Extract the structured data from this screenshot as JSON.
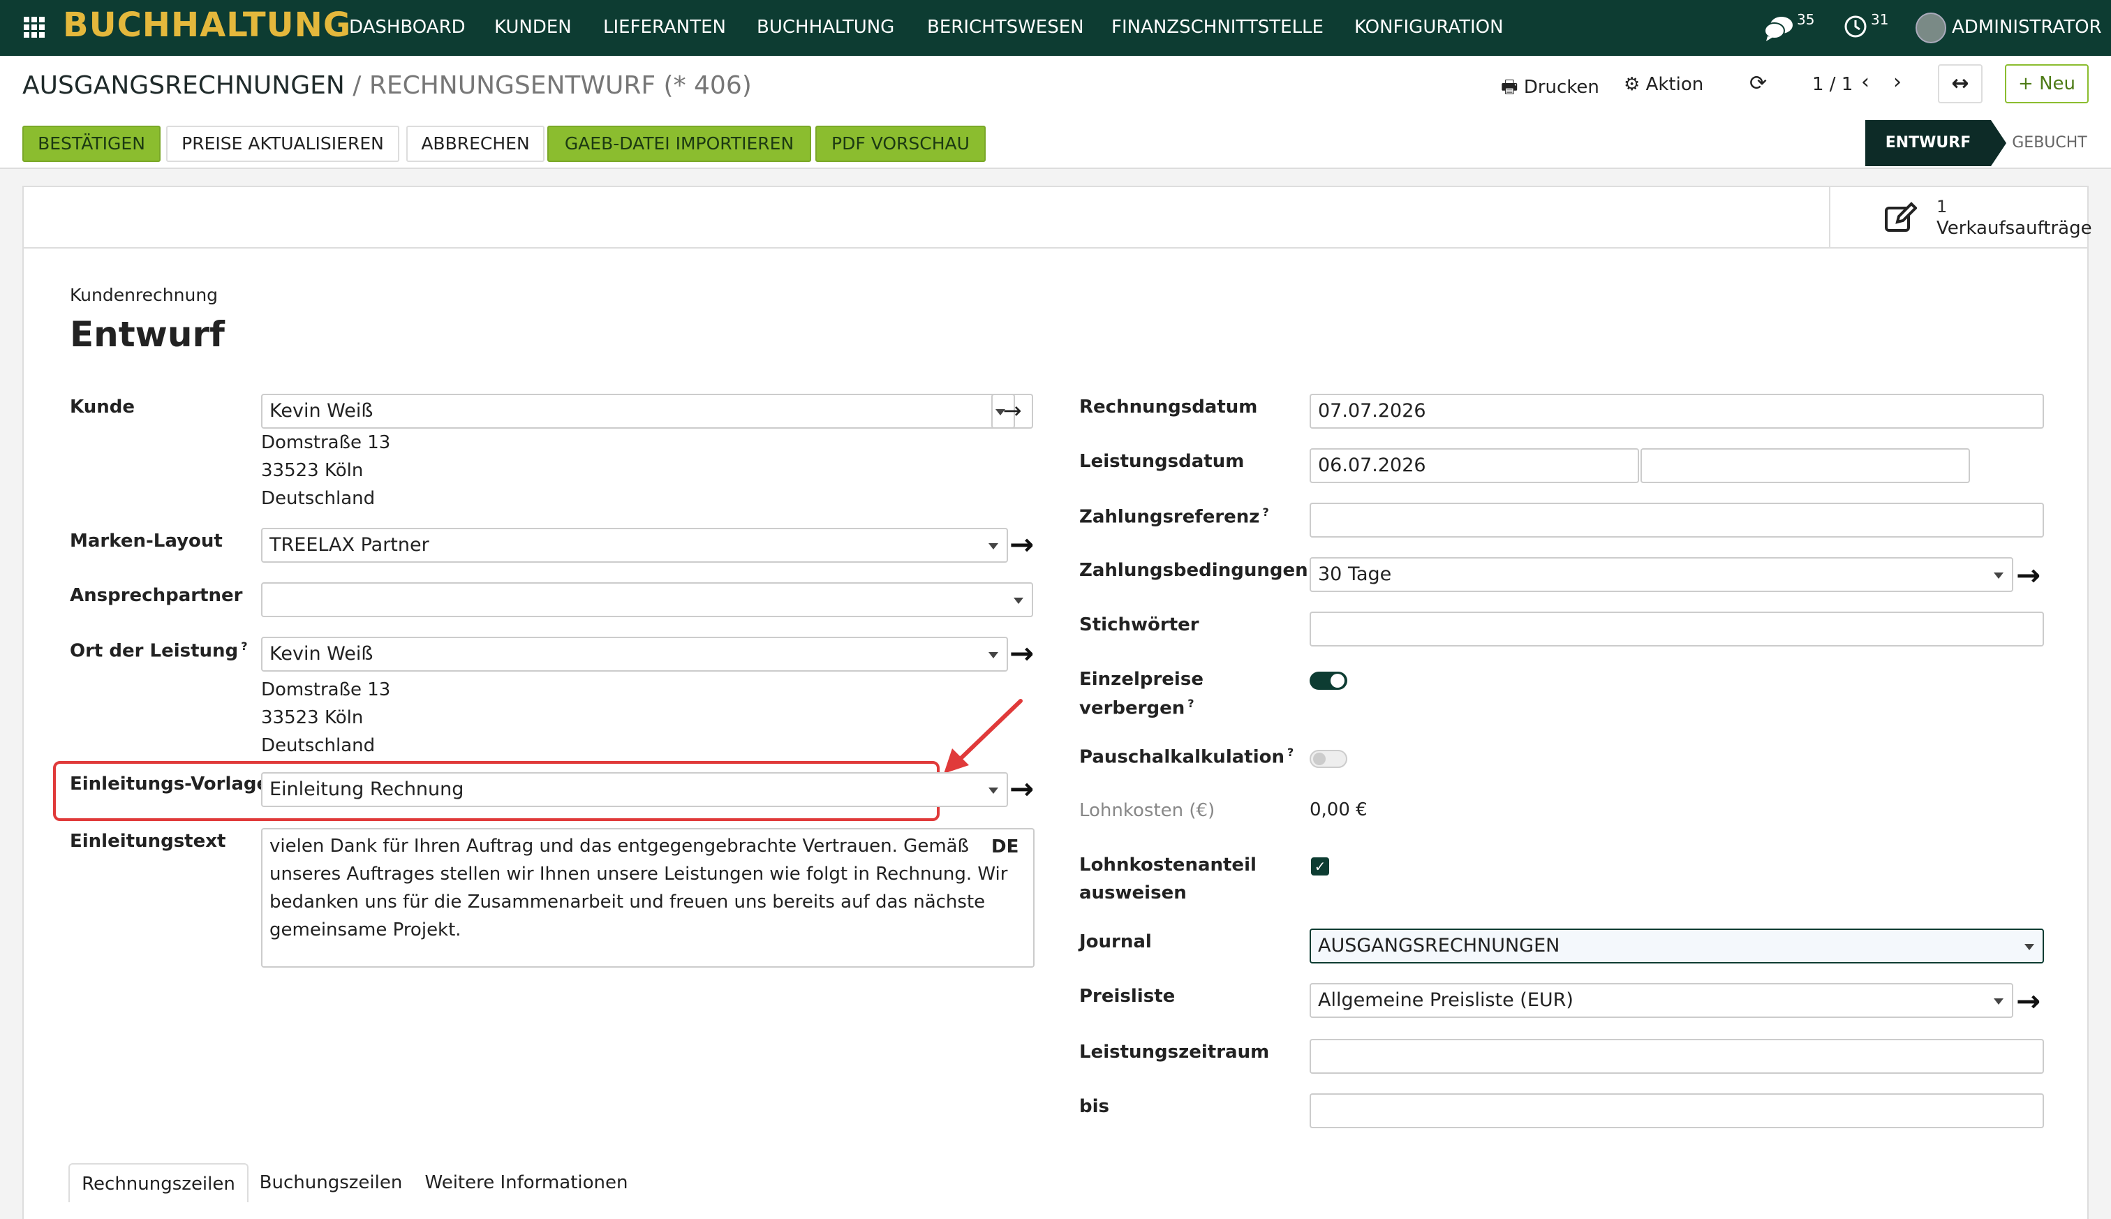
{
  "nav": {
    "brand": "BUCHHALTUNG",
    "items": [
      "DASHBOARD",
      "KUNDEN",
      "LIEFERANTEN",
      "BUCHHALTUNG",
      "BERICHTSWESEN",
      "FINANZSCHNITTSTELLE",
      "KONFIGURATION"
    ],
    "messages_count": "35",
    "activities_count": "31",
    "user": "ADMINISTRATOR"
  },
  "breadcrumb": {
    "parent": "AUSGANGSRECHNUNGEN",
    "separator": "/",
    "current": "RECHNUNGSENTWURF (* 406)"
  },
  "controls": {
    "print": "Drucken",
    "action": "Aktion",
    "pager": "1 / 1",
    "new": "Neu"
  },
  "actions": {
    "confirm": "BESTÄTIGEN",
    "update_prices": "PREISE AKTUALISIEREN",
    "cancel": "ABBRECHEN",
    "import_gaeb": "GAEB-DATEI IMPORTIEREN",
    "pdf_preview": "PDF VORSCHAU"
  },
  "status": {
    "active": "ENTWURF",
    "next": "GEBUCHT"
  },
  "smart_button": {
    "count": "1",
    "label": "Verkaufsaufträge"
  },
  "form": {
    "type_label": "Kundenrechnung",
    "title": "Entwurf",
    "left": {
      "customer_label": "Kunde",
      "customer": "Kevin Weiß",
      "customer_addr": [
        "Domstraße 13",
        "33523 Köln",
        "Deutschland"
      ],
      "brand_layout_label": "Marken-Layout",
      "brand_layout": "TREELAX Partner",
      "contact_label": "Ansprechpartner",
      "contact": "",
      "service_place_label": "Ort der Leistung",
      "service_place": "Kevin Weiß",
      "service_addr": [
        "Domstraße 13",
        "33523 Köln",
        "Deutschland"
      ],
      "intro_template_label": "Einleitungs-Vorlage",
      "intro_template": "Einleitung Rechnung",
      "intro_text_label": "Einleitungstext",
      "intro_text": [
        "vielen Dank für Ihren Auftrag und das entgegengebrachte Vertrauen. Gemäß",
        "unseres Auftrages stellen wir Ihnen unsere Leistungen wie folgt in Rechnung. Wir",
        "bedanken uns für die Zusammenarbeit und freuen uns bereits auf das nächste",
        "gemeinsame Projekt."
      ],
      "lang": "DE"
    },
    "right": {
      "invoice_date_label": "Rechnungsdatum",
      "invoice_date": "07.07.2026",
      "service_date_label": "Leistungsdatum",
      "service_date": "06.07.2026",
      "payment_ref_label": "Zahlungsreferenz",
      "payment_terms_label": "Zahlungsbedingungen",
      "payment_terms": "30 Tage",
      "tags_label": "Stichwörter",
      "hide_prices_label": [
        "Einzelpreise",
        "verbergen"
      ],
      "flat_calc_label": "Pauschalkalkulation",
      "labor_cost_label": "Lohnkosten (€)",
      "labor_cost": "0,00 €",
      "labor_share_label": [
        "Lohnkostenanteil",
        "ausweisen"
      ],
      "journal_label": "Journal",
      "journal": "AUSGANGSRECHNUNGEN",
      "pricelist_label": "Preisliste",
      "pricelist": "Allgemeine Preisliste (EUR)",
      "period_label": "Leistungszeitraum",
      "until_label": "bis"
    }
  },
  "tabs": [
    "Rechnungszeilen",
    "Buchungszeilen",
    "Weitere Informationen"
  ],
  "colors": {
    "topbar": "#0d3c32",
    "brand": "#e4b83c",
    "accent_green": "#8bbd2f",
    "highlight": "#e03a3a"
  }
}
